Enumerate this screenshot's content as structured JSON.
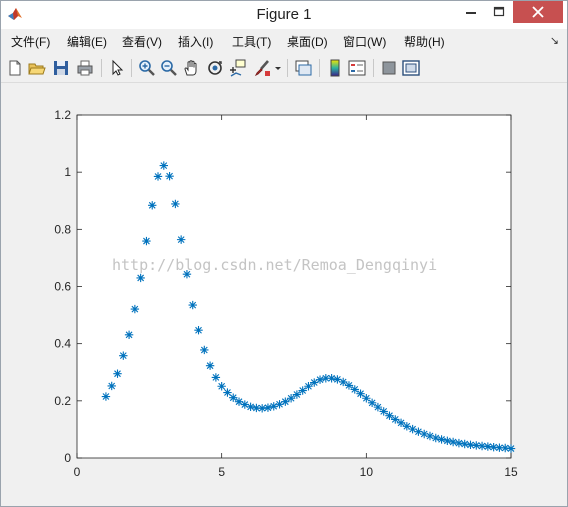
{
  "window": {
    "title": "Figure 1"
  },
  "menu": [
    "文件(F)",
    "编辑(E)",
    "查看(V)",
    "插入(I)",
    "工具(T)",
    "桌面(D)",
    "窗口(W)",
    "帮助(H)"
  ],
  "toolbar": {
    "icons": [
      "new-figure-icon",
      "open-file-icon",
      "save-icon",
      "print-icon",
      "select-arrow-icon",
      "zoom-in-icon",
      "zoom-out-icon",
      "pan-hand-icon",
      "rotate-3d-icon",
      "data-cursor-icon",
      "brush-icon",
      "brush-dropdown-icon",
      "link-plot-icon",
      "insert-colorbar-icon",
      "insert-legend-icon",
      "hide-plot-tools-icon",
      "show-plot-tools-icon"
    ]
  },
  "watermark": "http://blog.csdn.net/Remoa_Dengqinyi",
  "colors": {
    "marker": "#0072bd",
    "axes_bg": "#ffffff",
    "figure_bg": "#f0f0f0"
  },
  "chart_data": {
    "type": "scatter",
    "marker": "*",
    "xlim": [
      0,
      15
    ],
    "ylim": [
      0,
      1.2
    ],
    "xticks": [
      "0",
      "5",
      "10",
      "15"
    ],
    "yticks": [
      "0",
      "0.2",
      "0.4",
      "0.6",
      "0.8",
      "1",
      "1.2"
    ],
    "x": [
      1.0,
      1.2,
      1.4,
      1.6,
      1.8,
      2.0,
      2.2,
      2.4,
      2.6,
      2.8,
      3.0,
      3.2,
      3.4,
      3.6,
      3.8,
      4.0,
      4.2,
      4.4,
      4.6,
      4.8,
      5.0,
      5.2,
      5.4,
      5.6,
      5.8,
      6.0,
      6.2,
      6.4,
      6.6,
      6.8,
      7.0,
      7.2,
      7.4,
      7.6,
      7.8,
      8.0,
      8.2,
      8.4,
      8.6,
      8.8,
      9.0,
      9.2,
      9.4,
      9.6,
      9.8,
      10.0,
      10.2,
      10.4,
      10.6,
      10.8,
      11.0,
      11.2,
      11.4,
      11.6,
      11.8,
      12.0,
      12.2,
      12.4,
      12.6,
      12.8,
      13.0,
      13.2,
      13.4,
      13.6,
      13.8,
      14.0,
      14.2,
      14.4,
      14.6,
      14.8,
      15.0
    ],
    "y": [
      0.215,
      0.252,
      0.295,
      0.358,
      0.431,
      0.521,
      0.63,
      0.759,
      0.884,
      0.985,
      1.023,
      0.986,
      0.889,
      0.764,
      0.643,
      0.535,
      0.447,
      0.378,
      0.323,
      0.282,
      0.251,
      0.229,
      0.211,
      0.197,
      0.187,
      0.179,
      0.175,
      0.174,
      0.176,
      0.181,
      0.188,
      0.197,
      0.209,
      0.222,
      0.236,
      0.251,
      0.264,
      0.274,
      0.279,
      0.279,
      0.275,
      0.266,
      0.254,
      0.24,
      0.225,
      0.209,
      0.193,
      0.178,
      0.163,
      0.148,
      0.135,
      0.123,
      0.111,
      0.101,
      0.092,
      0.084,
      0.077,
      0.07,
      0.065,
      0.06,
      0.056,
      0.052,
      0.049,
      0.046,
      0.044,
      0.042,
      0.04,
      0.038,
      0.036,
      0.035,
      0.033
    ]
  }
}
